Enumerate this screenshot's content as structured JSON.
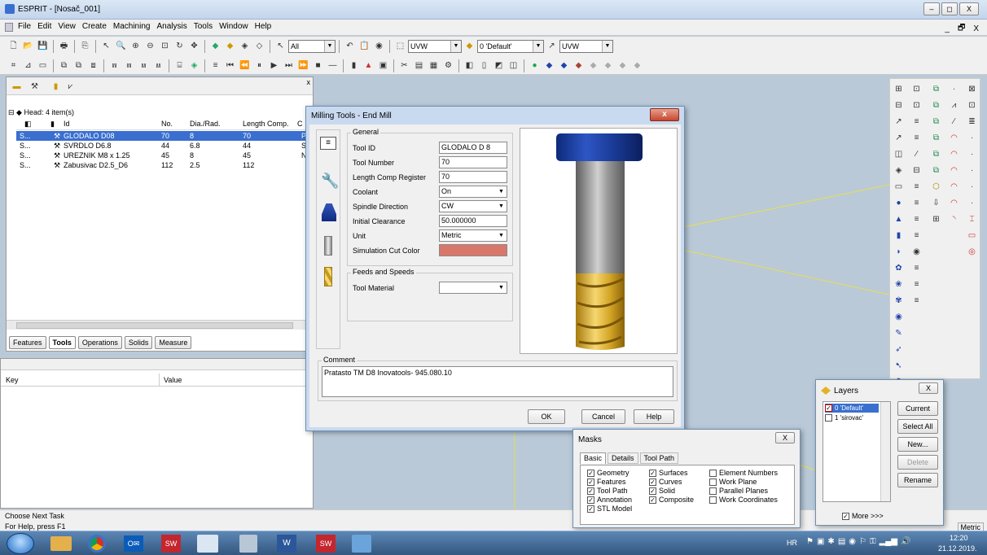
{
  "window": {
    "title": "ESPRIT - [Nosač_001]",
    "min": "–",
    "max": "◻",
    "close": "X"
  },
  "menu": {
    "items": [
      "File",
      "Edit",
      "View",
      "Create",
      "Machining",
      "Analysis",
      "Tools",
      "Window",
      "Help"
    ],
    "right": [
      "_",
      "🗗",
      "X"
    ]
  },
  "toolbar": {
    "combo_all": "All",
    "combo_uvw1": "UVW",
    "combo_layer": "0 'Default'",
    "combo_uvw2": "UVW"
  },
  "tree": {
    "head": "Head: 4 item(s)",
    "columns": [
      "Id",
      "No.",
      "Dia./Rad.",
      "Length Comp.",
      "C"
    ],
    "rows": [
      {
        "s": "S...",
        "id": "GLODALO D08",
        "no": "70",
        "dia": "8",
        "len": "70",
        "c": "Pr",
        "selected": true
      },
      {
        "s": "S...",
        "id": "SVRDLO D6.8",
        "no": "44",
        "dia": "6.8",
        "len": "44",
        "c": "S"
      },
      {
        "s": "S...",
        "id": "UREZNIK M8 x 1.25",
        "no": "45",
        "dia": "8",
        "len": "45",
        "c": "NA"
      },
      {
        "s": "S...",
        "id": "Zabusivac D2.5_D6",
        "no": "112",
        "dia": "2.5",
        "len": "112",
        "c": ""
      }
    ]
  },
  "tabs": [
    "Features",
    "Tools",
    "Operations",
    "Solids",
    "Measure"
  ],
  "props": {
    "key": "Key",
    "value": "Value"
  },
  "status": {
    "task": "Choose Next Task",
    "help": "For Help, press F1",
    "metric": "Metric",
    "right_frag": "Metric"
  },
  "dialog": {
    "title": "Milling Tools - End Mill",
    "close": "x",
    "general": "General",
    "fields": [
      {
        "label": "Tool ID",
        "value": "GLODALO D 8",
        "type": "text"
      },
      {
        "label": "Tool Number",
        "value": "70",
        "type": "text"
      },
      {
        "label": "Length Comp Register",
        "value": "70",
        "type": "text"
      },
      {
        "label": "Coolant",
        "value": "On",
        "type": "combo"
      },
      {
        "label": "Spindle Direction",
        "value": "CW",
        "type": "combo"
      },
      {
        "label": "Initial Clearance",
        "value": "50.000000",
        "type": "text"
      },
      {
        "label": "Unit",
        "value": "Metric",
        "type": "combo"
      },
      {
        "label": "Simulation Cut Color",
        "value": "",
        "type": "color"
      }
    ],
    "cut_color": "#d8776a",
    "feeds": "Feeds and Speeds",
    "tool_material": "Tool Material",
    "tool_material_value": "",
    "comment_label": "Comment",
    "comment": "Pratasto TM D8   Inovatools- 945.080.10",
    "ok": "OK",
    "cancel": "Cancel",
    "help": "Help"
  },
  "layers": {
    "title": "Layers",
    "close": "X",
    "items": [
      "0 'Default'",
      "1 'sirovac'"
    ],
    "buttons": [
      "Current",
      "Select All",
      "New...",
      "Delete",
      "Rename"
    ],
    "more": "More >>>"
  },
  "masks": {
    "title": "Masks",
    "close": "X",
    "tabs": [
      "Basic",
      "Details",
      "Tool Path"
    ],
    "col1": [
      {
        "t": "Geometry",
        "c": true
      },
      {
        "t": "Features",
        "c": true
      },
      {
        "t": "Tool Path",
        "c": true
      },
      {
        "t": "Annotation",
        "c": true
      },
      {
        "t": "STL Model",
        "c": true
      }
    ],
    "col2": [
      {
        "t": "Surfaces",
        "c": true
      },
      {
        "t": "Curves",
        "c": true
      },
      {
        "t": "Solid",
        "c": true
      },
      {
        "t": "Composite",
        "c": true
      }
    ],
    "col3": [
      {
        "t": "Element Numbers",
        "c": false
      },
      {
        "t": "Work Plane",
        "c": false
      },
      {
        "t": "Parallel Planes",
        "c": false
      },
      {
        "t": "Work Coordinates",
        "c": false
      }
    ]
  },
  "taskbar": {
    "lang": "HR",
    "time": "12:20",
    "date": "21.12.2019."
  },
  "colors": {
    "accent": "#3399ff",
    "select": "#3a6fd0",
    "titlebar": "#c9daf0",
    "canvas": "#b9c9d8",
    "coat": "#e7b936",
    "holder": "#1f3fa0"
  }
}
